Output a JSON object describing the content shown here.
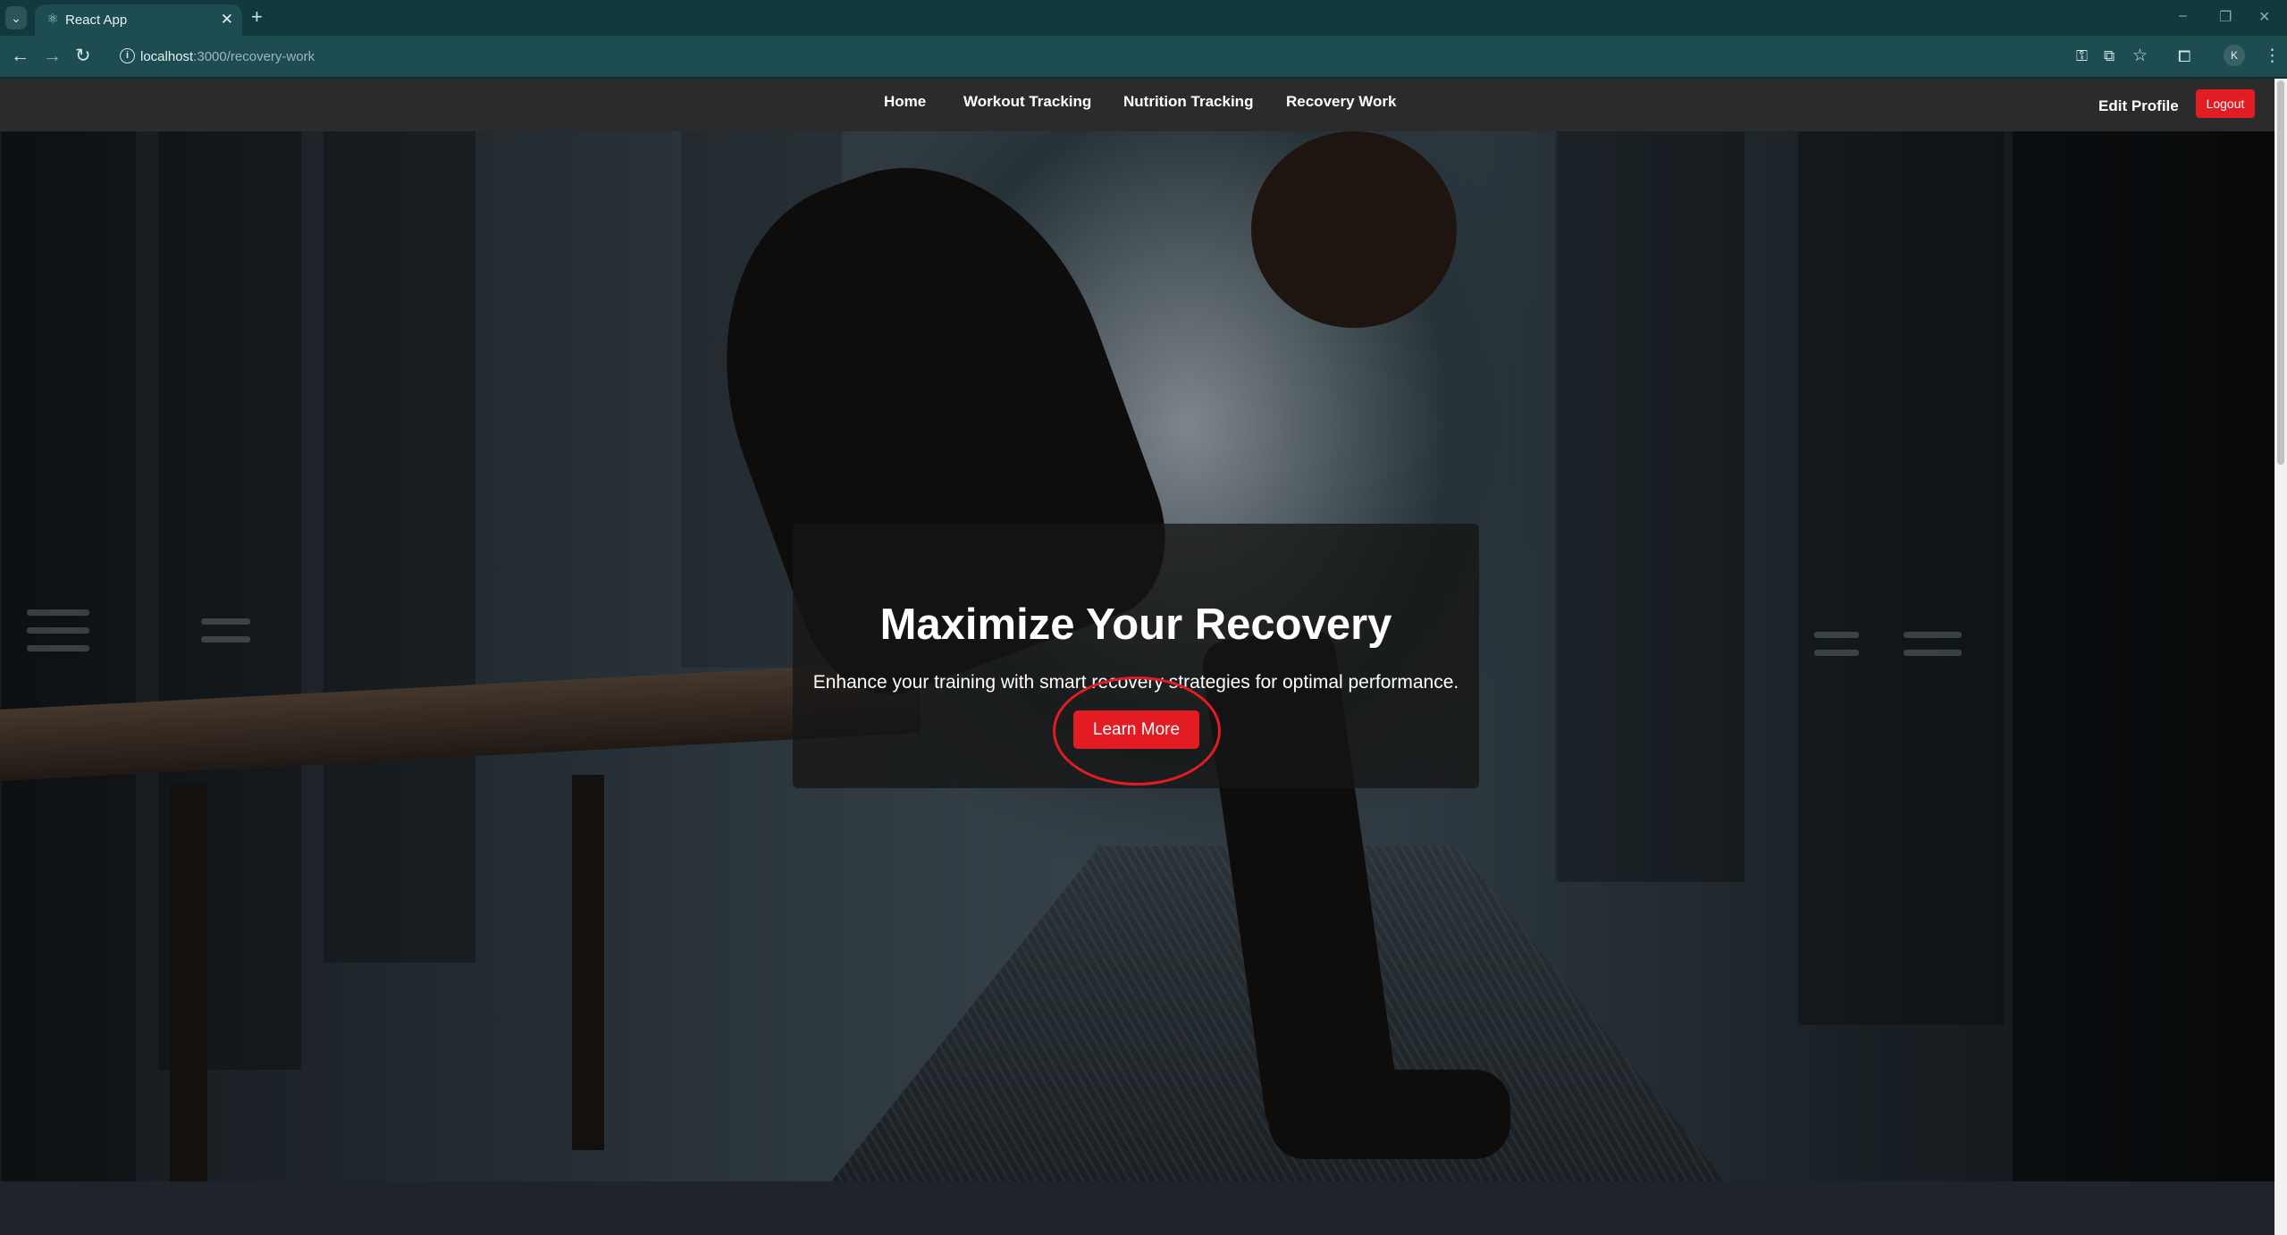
{
  "browser": {
    "tab_title": "React App",
    "tab_close": "✕",
    "new_tab": "+",
    "url_host": "localhost",
    "url_path": ":3000/recovery-work",
    "avatar_letter": "K",
    "window_controls": [
      "–",
      "❐",
      "✕"
    ]
  },
  "navbar": {
    "links": [
      "Home",
      "Workout Tracking",
      "Nutrition Tracking",
      "Recovery Work"
    ],
    "edit_profile": "Edit Profile",
    "logout": "Logout"
  },
  "hero": {
    "title": "Maximize Your Recovery",
    "subtitle": "Enhance your training with smart recovery strategies for optimal performance.",
    "cta": "Learn More"
  },
  "colors": {
    "accent": "#e31b23",
    "navbar_bg": "#2b2b2b",
    "chrome_bg": "#1d4d52"
  }
}
